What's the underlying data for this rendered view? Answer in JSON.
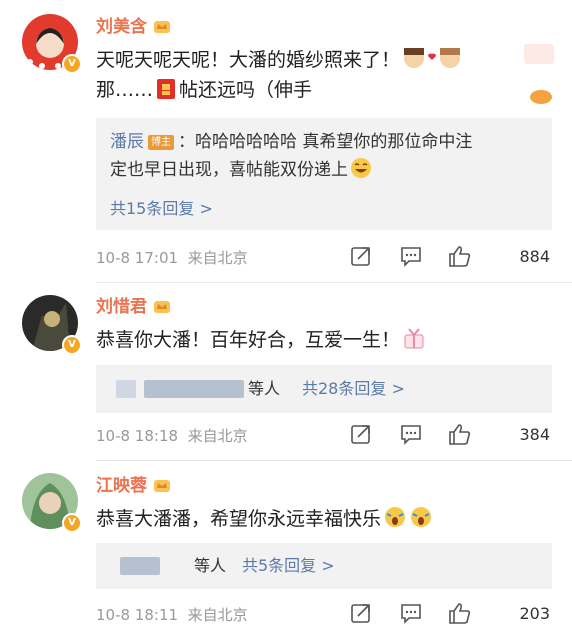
{
  "comments": [
    {
      "username": "刘美含",
      "text_a": "天呢天呢天呢！大潘的婚纱照来了！",
      "text_b_1": "那……",
      "text_b_2": "帖还远吗（伸手",
      "reply": {
        "name": "潘辰",
        "tag": "博主",
        "text_1": "：哈哈哈哈哈哈  真希望你的那位命中注",
        "text_2": "定也早日出现，喜帖能双份递上"
      },
      "more": "共15条回复 >",
      "time": "10-8 17:01",
      "location": "来自北京",
      "likes": "884"
    },
    {
      "username": "刘惜君",
      "text_a": "恭喜你大潘！百年好合，互爱一生！",
      "more_prefix": "等人",
      "more": "共28条回复 >",
      "time": "10-8 18:18",
      "location": "来自北京",
      "likes": "384"
    },
    {
      "username": "江映蓉",
      "text_a": "恭喜大潘潘，希望你永远幸福快乐",
      "more_prefix": "等人",
      "more": "共5条回复 >",
      "time": "10-8 18:11",
      "location": "来自北京",
      "likes": "203"
    }
  ],
  "colors": {
    "username": "#eb7350",
    "link": "#5b7aa8",
    "meta": "#999999",
    "replyBg": "#f2f2f2",
    "badge": "#f5a623"
  },
  "icons": [
    "crown-icon",
    "verified-badge-icon",
    "share-icon",
    "comment-icon",
    "like-icon"
  ]
}
